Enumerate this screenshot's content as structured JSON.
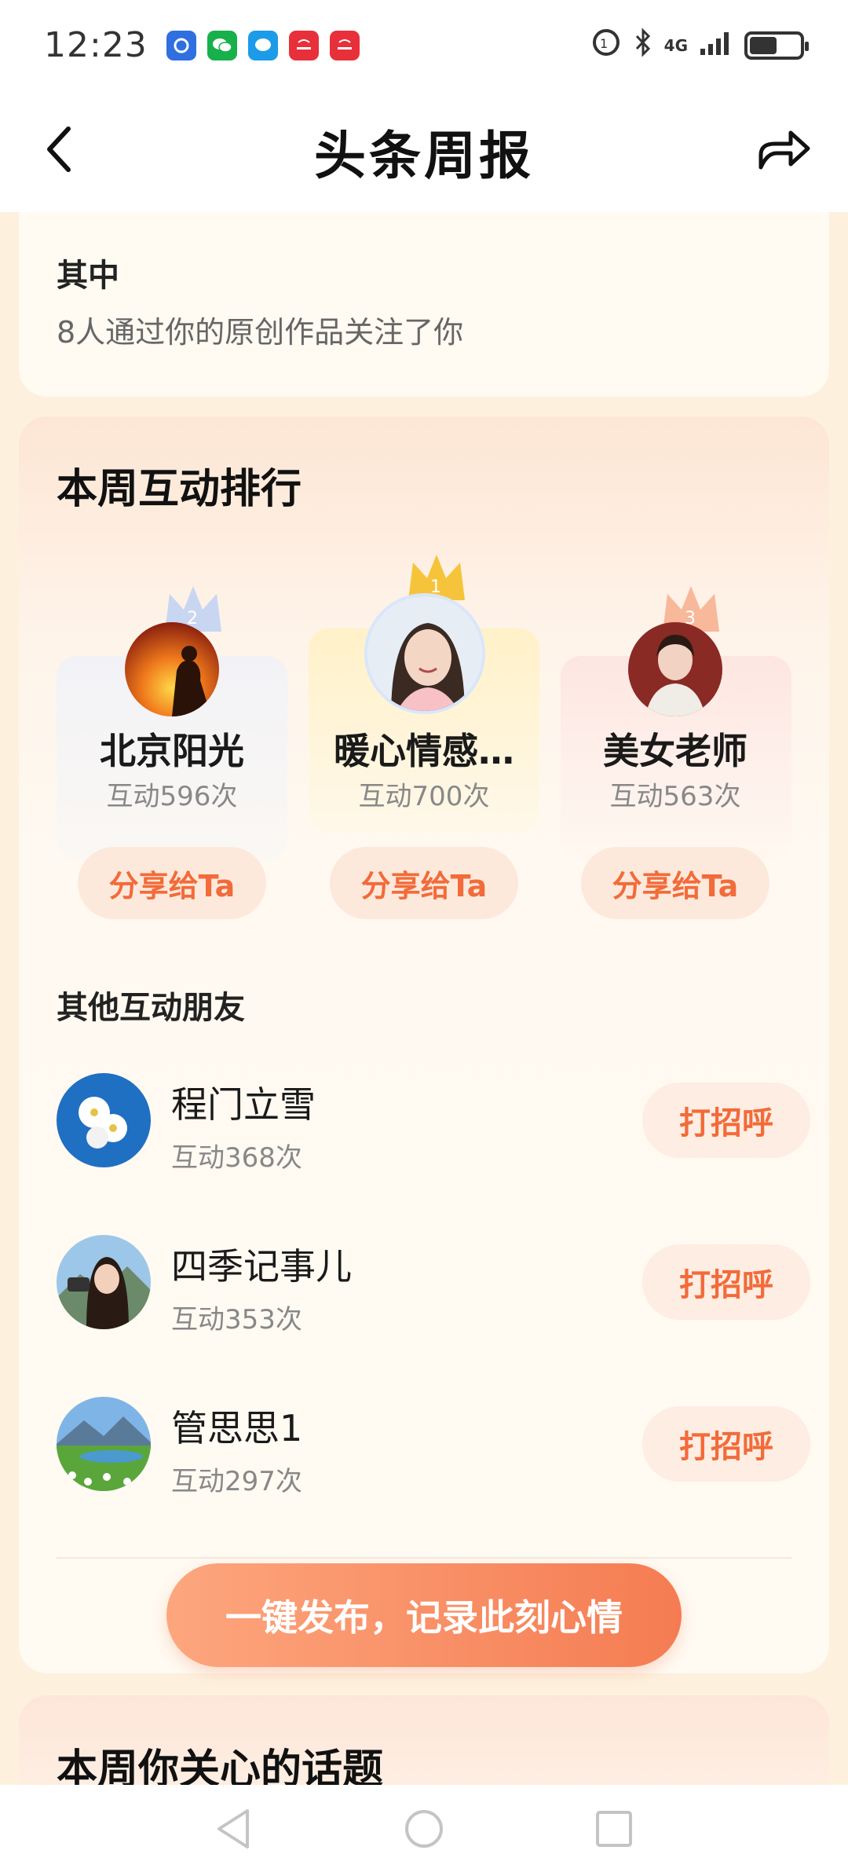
{
  "status_bar": {
    "time": "12:23",
    "notifications": [
      {
        "icon": "app-blue-icon",
        "color": "#2f6fe0"
      },
      {
        "icon": "wechat-icon",
        "color": "#18b04a"
      },
      {
        "icon": "message-icon",
        "color": "#1c9be8"
      },
      {
        "icon": "huawei-icon",
        "color": "#e8303a"
      },
      {
        "icon": "huawei-icon",
        "color": "#e8303a"
      }
    ],
    "network": "4G"
  },
  "header": {
    "title": "头条周报"
  },
  "summary": {
    "heading": "其中",
    "text": "8人通过你的原创作品关注了你"
  },
  "ranking": {
    "title": "本周互动排行",
    "top": [
      {
        "rank": "2",
        "name": "北京阳光",
        "count": "互动596次",
        "button": "分享给Ta"
      },
      {
        "rank": "1",
        "name": "暖心情感…",
        "count": "互动700次",
        "button": "分享给Ta"
      },
      {
        "rank": "3",
        "name": "美女老师",
        "count": "互动563次",
        "button": "分享给Ta"
      }
    ],
    "others_title": "其他互动朋友",
    "others": [
      {
        "name": "程门立雪",
        "count": "互动368次",
        "button": "打招呼"
      },
      {
        "name": "四季记事儿",
        "count": "互动353次",
        "button": "打招呼"
      },
      {
        "name": "管思思1",
        "count": "互动297次",
        "button": "打招呼"
      }
    ],
    "publish_button": "一键发布，记录此刻心情"
  },
  "topics": {
    "title": "本周你关心的话题"
  },
  "colors": {
    "accent": "#f26b3a",
    "background": "#fdf1de"
  }
}
